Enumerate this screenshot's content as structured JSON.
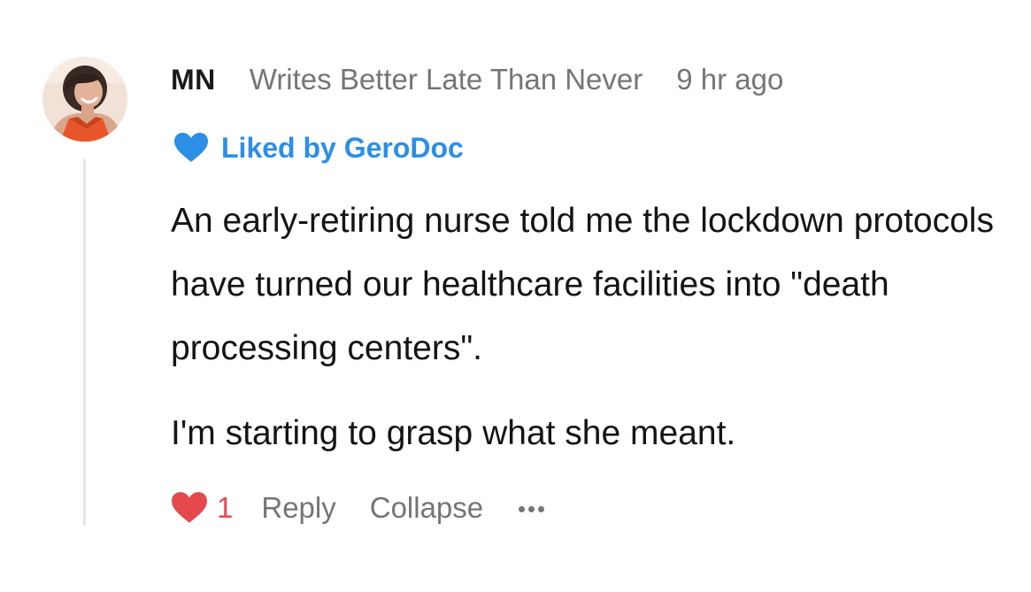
{
  "comment": {
    "author": "MN",
    "publication": "Writes Better Late Than Never",
    "timestamp": "9 hr ago",
    "liked_by": "Liked by GeroDoc",
    "paragraphs": [
      "An early-retiring nurse told me the lockdown protocols have turned our healthcare facilities into \"death processing centers\".",
      "I'm starting to grasp what she meant."
    ],
    "like_count": "1",
    "actions": {
      "reply": "Reply",
      "collapse": "Collapse"
    },
    "icons": {
      "liked_by": "heart-icon",
      "like": "heart-icon",
      "more": "ellipsis-icon"
    },
    "colors": {
      "liked_by": "#2d8ee6",
      "like": "#e5484d",
      "muted": "#757575"
    }
  }
}
